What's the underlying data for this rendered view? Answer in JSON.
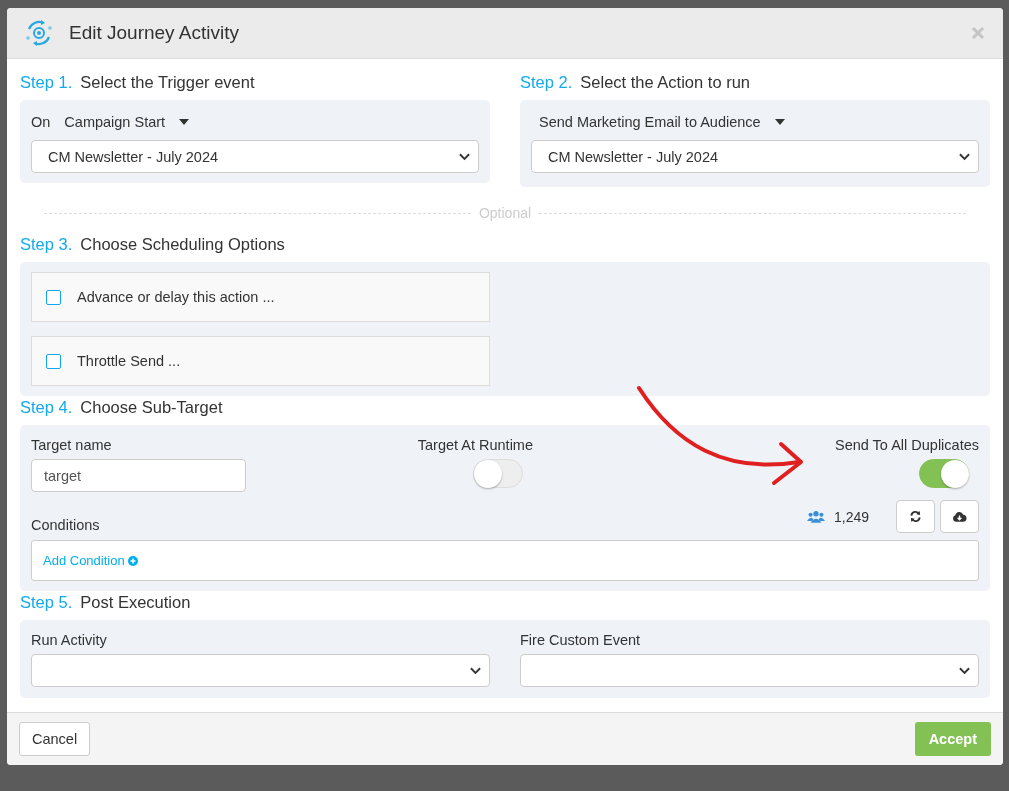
{
  "window": {
    "title": "Edit Journey Activity"
  },
  "trigger": {
    "step": "Step 1.",
    "title": "Select the Trigger event",
    "prefix": "On",
    "event": "Campaign Start",
    "value": "CM Newsletter - July 2024"
  },
  "action": {
    "step": "Step 2.",
    "title": "Select the Action to run",
    "action": "Send Marketing Email to Audience",
    "value": "CM Newsletter - July 2024"
  },
  "divider_label": "Optional",
  "scheduling": {
    "step": "Step 3.",
    "title": "Choose Scheduling Options",
    "options": [
      {
        "label": "Advance or delay this action ...",
        "checked": false
      },
      {
        "label": "Throttle Send ...",
        "checked": false
      }
    ]
  },
  "sub_target": {
    "step": "Step 4.",
    "title": "Choose Sub-Target",
    "target_name": {
      "label": "Target name",
      "value": "target"
    },
    "runtime": {
      "label": "Target At Runtime",
      "on": false
    },
    "duplicates": {
      "label": "Send To All Duplicates",
      "on": true
    },
    "count": "1,249",
    "conditions_label": "Conditions",
    "add_condition": "Add Condition"
  },
  "post": {
    "step": "Step 5.",
    "title": "Post Execution",
    "fields": [
      {
        "label": "Run Activity"
      },
      {
        "label": "Fire Custom Event"
      }
    ]
  },
  "buttons": {
    "cancel": "Cancel",
    "accept": "Accept"
  }
}
